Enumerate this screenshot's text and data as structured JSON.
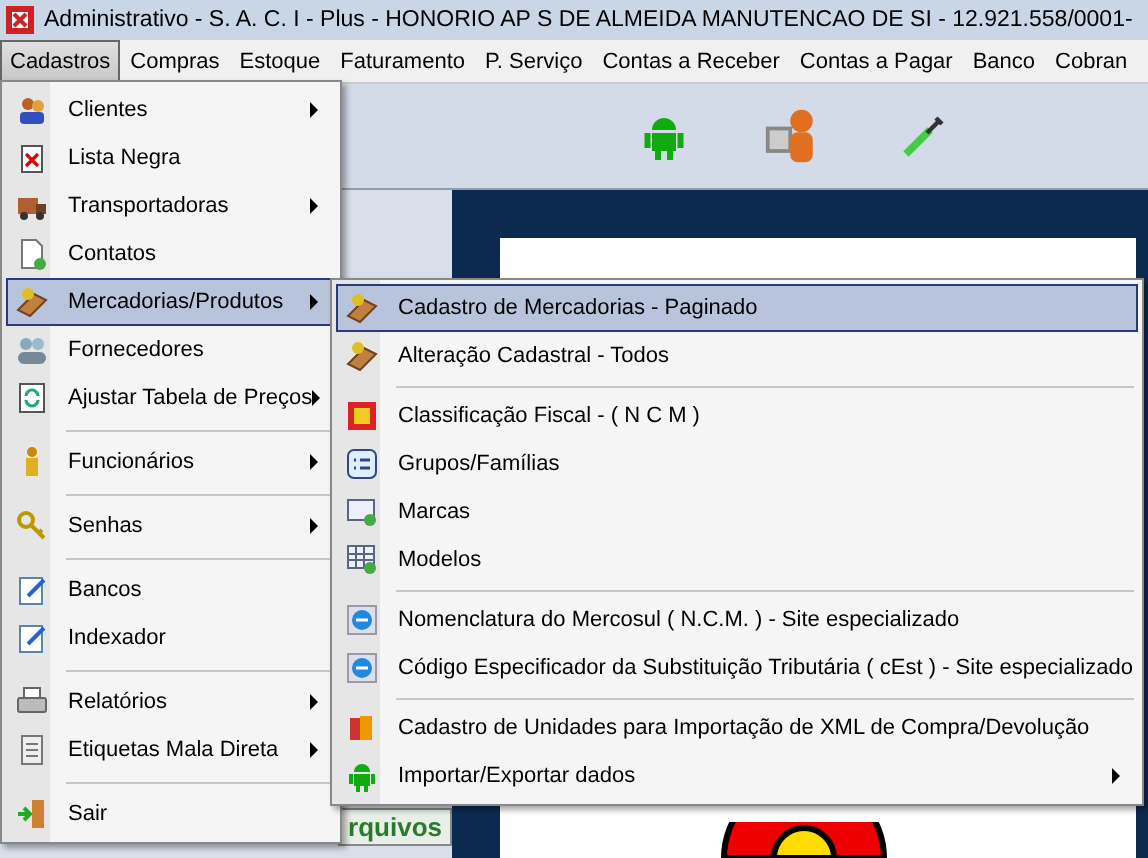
{
  "window": {
    "title": "Administrativo - S. A. C. I - Plus - HONORIO AP S DE ALMEIDA MANUTENCAO DE SI - 12.921.558/0001-"
  },
  "menubar": [
    {
      "label": "Cadastros",
      "selected": true
    },
    {
      "label": "Compras",
      "selected": false
    },
    {
      "label": "Estoque",
      "selected": false
    },
    {
      "label": "Faturamento",
      "selected": false
    },
    {
      "label": "P. Serviço",
      "selected": false
    },
    {
      "label": "Contas a Receber",
      "selected": false
    },
    {
      "label": "Contas a Pagar",
      "selected": false
    },
    {
      "label": "Banco",
      "selected": false
    },
    {
      "label": "Cobran",
      "selected": false
    }
  ],
  "background": {
    "tab_label": "rquivos"
  },
  "menu": [
    {
      "kind": "item",
      "label": "Clientes",
      "submenu": true,
      "selected": false
    },
    {
      "kind": "item",
      "label": "Lista Negra",
      "submenu": false,
      "selected": false
    },
    {
      "kind": "item",
      "label": "Transportadoras",
      "submenu": true,
      "selected": false
    },
    {
      "kind": "item",
      "label": "Contatos",
      "submenu": false,
      "selected": false
    },
    {
      "kind": "item",
      "label": "Mercadorias/Produtos",
      "submenu": true,
      "selected": true
    },
    {
      "kind": "item",
      "label": "Fornecedores",
      "submenu": false,
      "selected": false
    },
    {
      "kind": "item",
      "label": "Ajustar Tabela de Preços",
      "submenu": true,
      "selected": false
    },
    {
      "kind": "separator"
    },
    {
      "kind": "item",
      "label": "Funcionários",
      "submenu": true,
      "selected": false
    },
    {
      "kind": "separator"
    },
    {
      "kind": "item",
      "label": "Senhas",
      "submenu": true,
      "selected": false
    },
    {
      "kind": "separator"
    },
    {
      "kind": "item",
      "label": "Bancos",
      "submenu": false,
      "selected": false
    },
    {
      "kind": "item",
      "label": "Indexador",
      "submenu": false,
      "selected": false
    },
    {
      "kind": "separator"
    },
    {
      "kind": "item",
      "label": "Relatórios",
      "submenu": true,
      "selected": false
    },
    {
      "kind": "item",
      "label": "Etiquetas Mala Direta",
      "submenu": true,
      "selected": false
    },
    {
      "kind": "separator"
    },
    {
      "kind": "item",
      "label": "Sair",
      "submenu": false,
      "selected": false
    }
  ],
  "submenu": [
    {
      "kind": "item",
      "label": "Cadastro de Mercadorias - Paginado",
      "submenu": false,
      "selected": true
    },
    {
      "kind": "item",
      "label": "Alteração Cadastral - Todos",
      "submenu": false,
      "selected": false
    },
    {
      "kind": "separator"
    },
    {
      "kind": "item",
      "label": "Classificação Fiscal - ( N C M )",
      "submenu": false,
      "selected": false
    },
    {
      "kind": "item",
      "label": "Grupos/Famílias",
      "submenu": false,
      "selected": false
    },
    {
      "kind": "item",
      "label": "Marcas",
      "submenu": false,
      "selected": false
    },
    {
      "kind": "item",
      "label": "Modelos",
      "submenu": false,
      "selected": false
    },
    {
      "kind": "separator"
    },
    {
      "kind": "item",
      "label": "Nomenclatura do Mercosul ( N.C.M. ) - Site especializado",
      "submenu": false,
      "selected": false
    },
    {
      "kind": "item",
      "label": "Código Especificador da Substituição Tributária ( cEst ) - Site especializado",
      "submenu": false,
      "selected": false
    },
    {
      "kind": "separator"
    },
    {
      "kind": "item",
      "label": "Cadastro de Unidades para Importação de XML de Compra/Devolução",
      "submenu": false,
      "selected": false
    },
    {
      "kind": "item",
      "label": "Importar/Exportar dados",
      "submenu": true,
      "selected": false
    }
  ]
}
